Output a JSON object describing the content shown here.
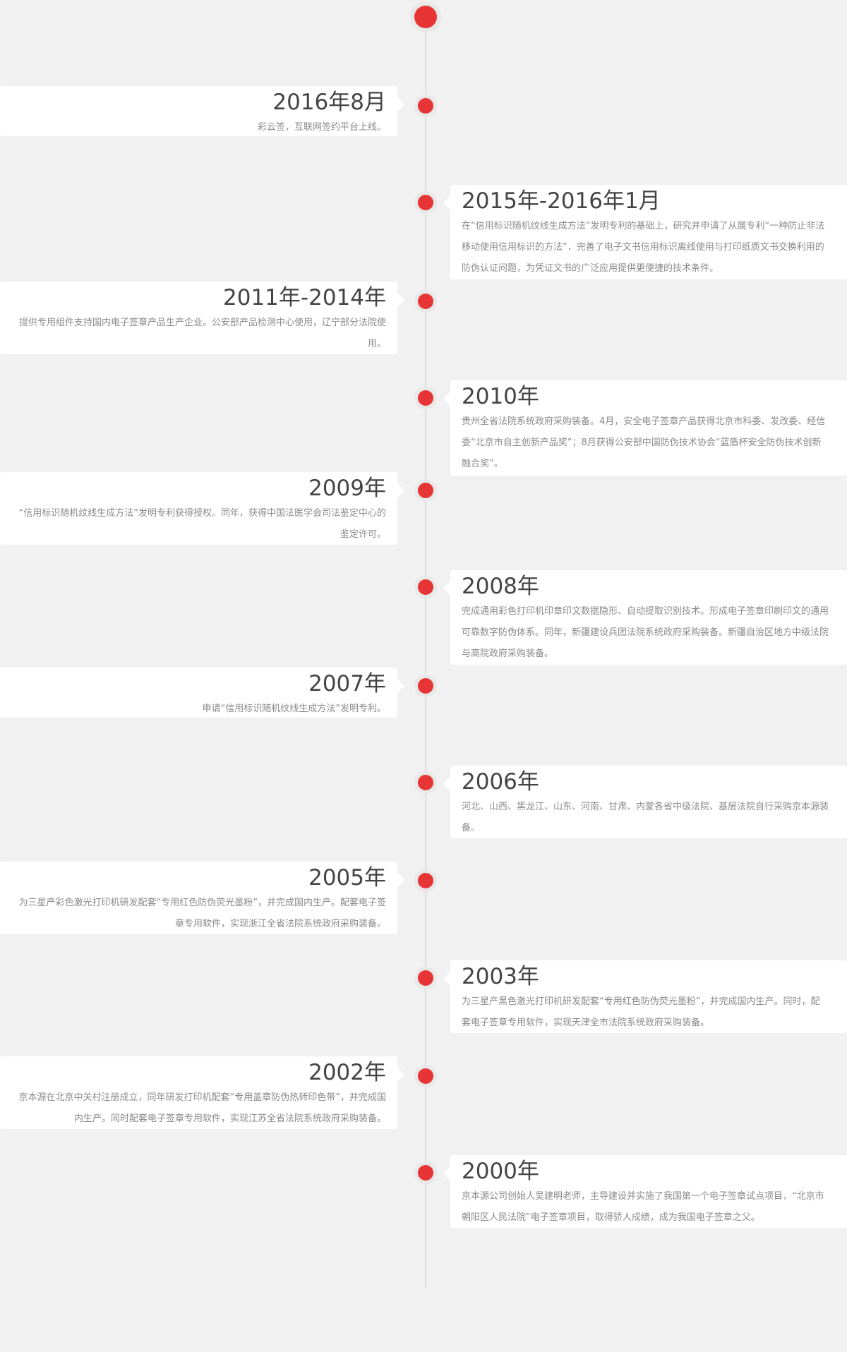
{
  "accent_color": "#e63534",
  "timeline": [
    {
      "year": "2016年8月",
      "desc": "彩云签，互联网签约平台上线。"
    },
    {
      "year": "2015年-2016年1月",
      "desc": "在“信用标识随机纹线生成方法”发明专利的基础上，研究并申请了从属专利“一种防止非法移动使用信用标识的方法”，完善了电子文书信用标识离线使用与打印纸质文书交换利用的防伪认证问题，为凭证文书的广泛应用提供更便捷的技术条件。"
    },
    {
      "year": "2011年-2014年",
      "desc": "提供专用组件支持国内电子签章产品生产企业。公安部产品检测中心使用，辽宁部分法院使用。"
    },
    {
      "year": "2010年",
      "desc": "贵州全省法院系统政府采购装备。4月，安全电子签章产品获得北京市科委、发改委、经信委“北京市自主创新产品奖”；8月获得公安部中国防伪技术协会“蓝盾杯安全防伪技术创新融合奖”。"
    },
    {
      "year": "2009年",
      "desc": "“信用标识随机纹线生成方法”发明专利获得授权。同年，获得中国法医学会司法鉴定中心的鉴定许可。"
    },
    {
      "year": "2008年",
      "desc": "完成通用彩色打印机印章印文数据隐形、自动提取识别技术。形成电子签章印刷印文的通用可靠数字防伪体系。同年，新疆建设兵团法院系统政府采购装备。新疆自治区地方中级法院与高院政府采购装备。"
    },
    {
      "year": "2007年",
      "desc": "申请“信用标识随机纹线生成方法”发明专利。"
    },
    {
      "year": "2006年",
      "desc": "河北、山西、黑龙江、山东、河南、甘肃、内蒙各省中级法院、基层法院自行采购京本源装备。"
    },
    {
      "year": "2005年",
      "desc": "为三星产彩色激光打印机研发配套“专用红色防伪荧光墨粉”，并完成国内生产。配套电子签章专用软件，实现浙江全省法院系统政府采购装备。"
    },
    {
      "year": "2003年",
      "desc": "为三星产黑色激光打印机研发配套“专用红色防伪荧光墨粉”，并完成国内生产。同时，配套电子签章专用软件，实现天津全市法院系统政府采购装备。"
    },
    {
      "year": "2002年",
      "desc": "京本源在北京中关村注册成立，同年研发打印机配套“专用盖章防伪热转印色带”，并完成国内生产。同时配套电子签章专用软件，实现江苏全省法院系统政府采购装备。"
    },
    {
      "year": "2000年",
      "desc": "京本源公司创始人吴建明老师，主导建设并实施了我国第一个电子签章试点项目，“北京市朝阳区人民法院”电子签章项目，取得骄人成绩，成为我国电子签章之父。"
    }
  ]
}
